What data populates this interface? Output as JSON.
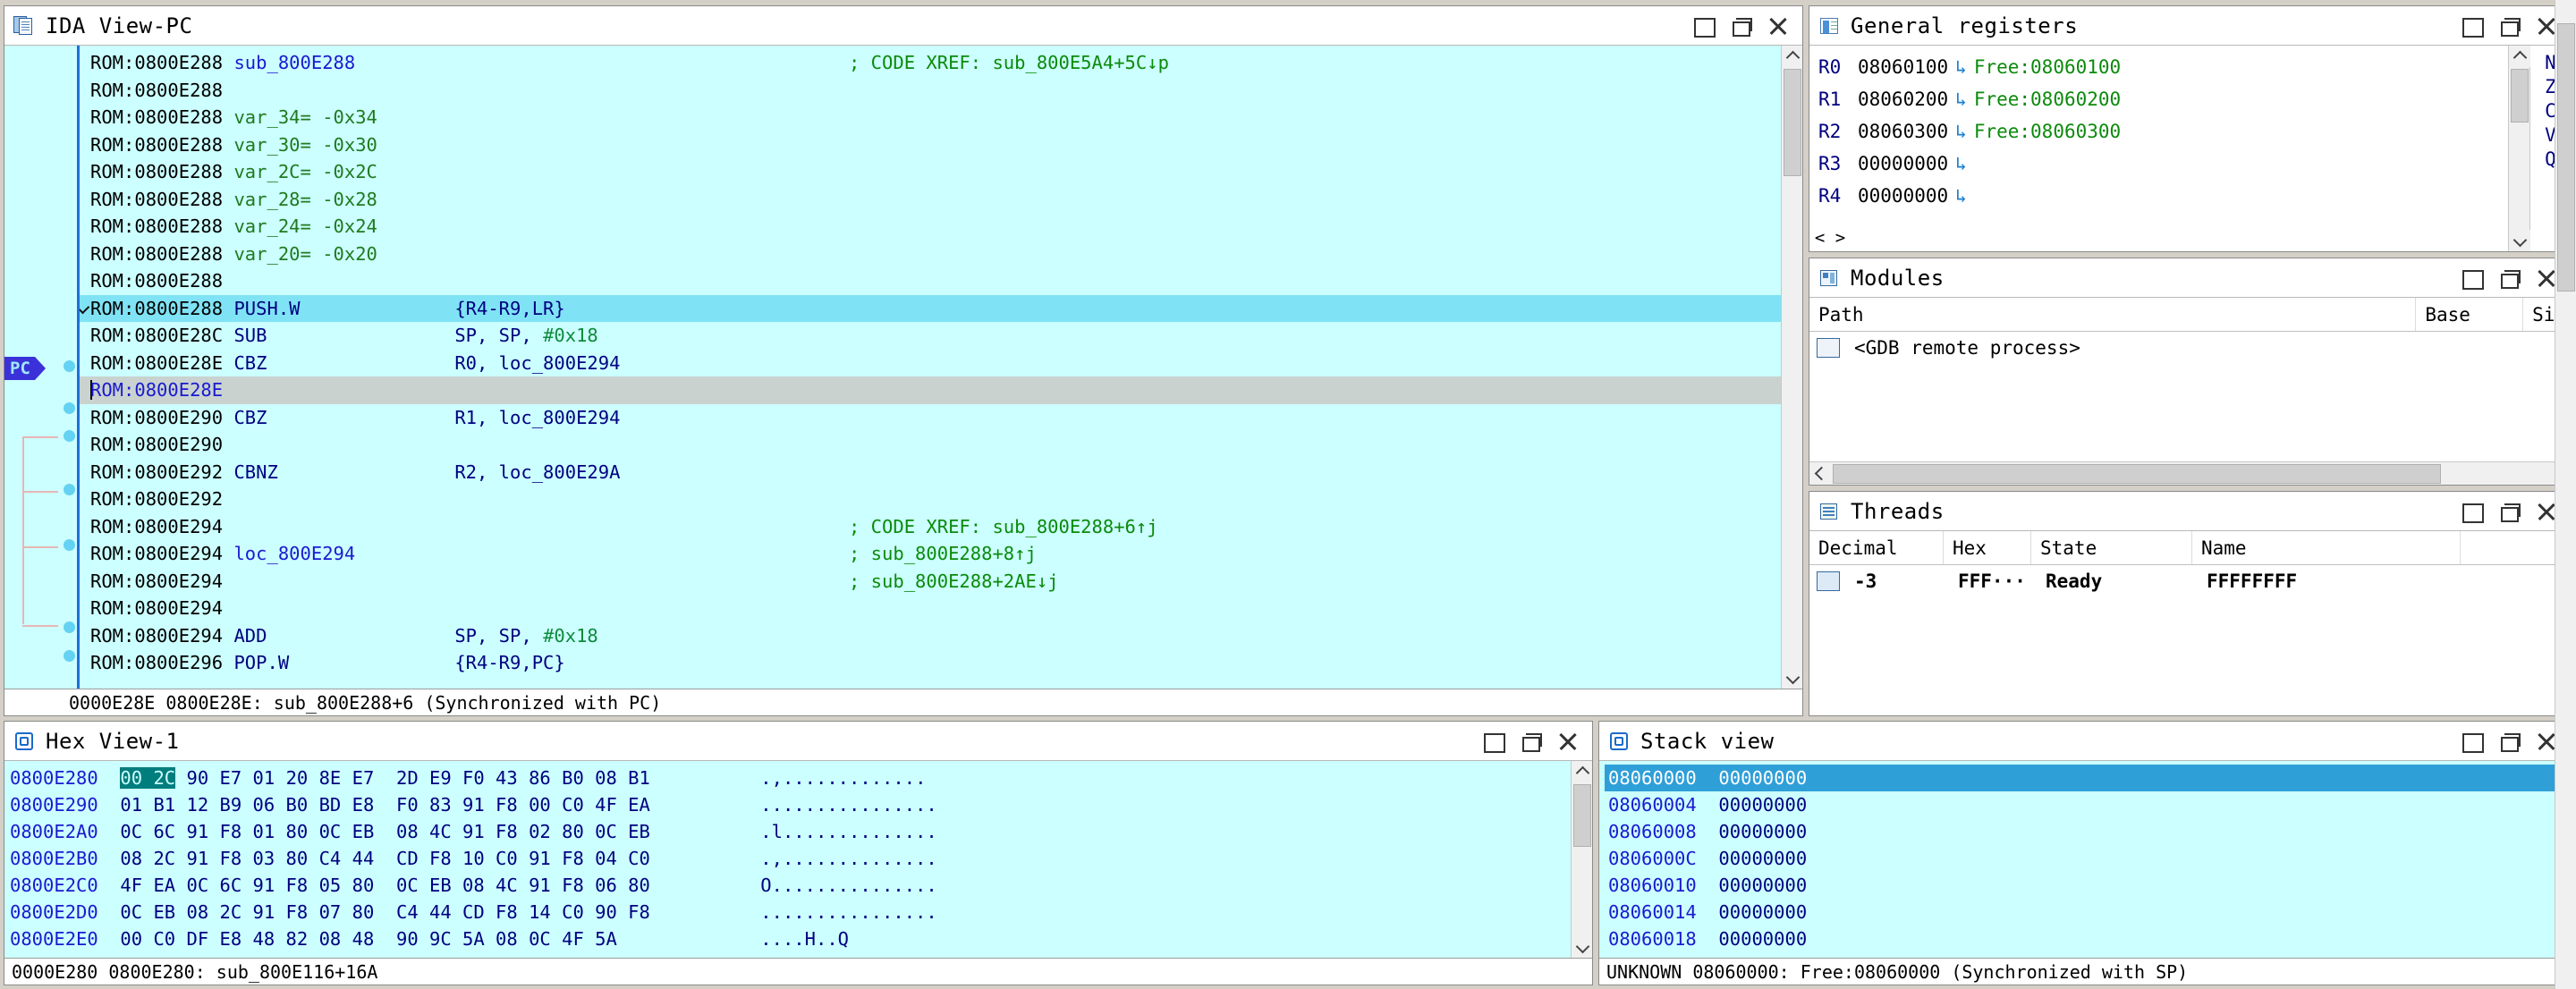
{
  "ida_view": {
    "title": "IDA View-PC",
    "icon": "document-pages-icon",
    "pc_marker": "PC",
    "comment_column": [
      {
        "row": 0,
        "text": "; CODE XREF: sub_800E5A4+5C↓p"
      },
      {
        "row": 17,
        "text": "; CODE XREF: sub_800E288+6↑j"
      },
      {
        "row": 18,
        "text": "; sub_800E288+8↑j"
      },
      {
        "row": 19,
        "text": "; sub_800E288+2AE↓j"
      }
    ],
    "lines": [
      {
        "seg": "ROM:0800E288",
        "mnem": "",
        "op": "",
        "name": "sub_800E288"
      },
      {
        "seg": "ROM:0800E288",
        "mnem": "",
        "op": ""
      },
      {
        "seg": "ROM:0800E288",
        "var": "var_34= -0x34"
      },
      {
        "seg": "ROM:0800E288",
        "var": "var_30= -0x30"
      },
      {
        "seg": "ROM:0800E288",
        "var": "var_2C= -0x2C"
      },
      {
        "seg": "ROM:0800E288",
        "var": "var_28= -0x28"
      },
      {
        "seg": "ROM:0800E288",
        "var": "var_24= -0x24"
      },
      {
        "seg": "ROM:0800E288",
        "var": "var_20= -0x20"
      },
      {
        "seg": "ROM:0800E288",
        "mnem": "",
        "op": ""
      },
      {
        "seg": "ROM:0800E288",
        "mnem": "PUSH.W",
        "op": "{R4-R9,LR}",
        "pc": true,
        "chevron": true
      },
      {
        "seg": "ROM:0800E28C",
        "mnem": "SUB",
        "op": "SP, SP, #0x18"
      },
      {
        "seg": "ROM:0800E28E",
        "mnem": "CBZ",
        "op": "R0, loc_800E294"
      },
      {
        "seg": "ROM:0800E28E",
        "mnem": "",
        "op": "",
        "cursor": true
      },
      {
        "seg": "ROM:0800E290",
        "mnem": "CBZ",
        "op": "R1, loc_800E294"
      },
      {
        "seg": "ROM:0800E290",
        "mnem": "",
        "op": ""
      },
      {
        "seg": "ROM:0800E292",
        "mnem": "CBNZ",
        "op": "R2, loc_800E29A"
      },
      {
        "seg": "ROM:0800E292",
        "mnem": "",
        "op": ""
      },
      {
        "seg": "ROM:0800E294",
        "mnem": "",
        "op": ""
      },
      {
        "seg": "ROM:0800E294",
        "mnem": "",
        "op": "",
        "name": "loc_800E294"
      },
      {
        "seg": "ROM:0800E294",
        "mnem": "",
        "op": ""
      },
      {
        "seg": "ROM:0800E294",
        "mnem": "",
        "op": ""
      },
      {
        "seg": "ROM:0800E294",
        "mnem": "ADD",
        "op": "SP, SP, #0x18"
      },
      {
        "seg": "ROM:0800E296",
        "mnem": "POP.W",
        "op": "{R4-R9,PC}"
      }
    ],
    "statusbar": "0000E28E 0800E28E: sub_800E288+6 (Synchronized with PC)"
  },
  "registers": {
    "title": "General registers",
    "icon": "registers-icon",
    "rows": [
      {
        "name": "R0",
        "value": "08060100",
        "arrow": "↳",
        "symbol": "Free:08060100"
      },
      {
        "name": "R1",
        "value": "08060200",
        "arrow": "↳",
        "symbol": "Free:08060200"
      },
      {
        "name": "R2",
        "value": "08060300",
        "arrow": "↳",
        "symbol": "Free:08060300"
      },
      {
        "name": "R3",
        "value": "00000000",
        "arrow": "↳",
        "symbol": ""
      },
      {
        "name": "R4",
        "value": "00000000",
        "arrow": "↳",
        "symbol": ""
      }
    ],
    "flags": [
      "N",
      "Z",
      "C",
      "V",
      "Q"
    ]
  },
  "modules": {
    "title": "Modules",
    "icon": "modules-icon",
    "columns": [
      "Path",
      "Base",
      "Si"
    ],
    "rows": [
      {
        "path": "<GDB remote process>",
        "base": "",
        "size": ""
      }
    ]
  },
  "threads": {
    "title": "Threads",
    "icon": "threads-icon",
    "columns": [
      "Decimal",
      "Hex",
      "State",
      "Name"
    ],
    "rows": [
      {
        "decimal": "-3",
        "hex": "FFF···",
        "state": "Ready",
        "name": "FFFFFFFF"
      }
    ]
  },
  "hex_view": {
    "title": "Hex View-1",
    "icon": "hex-icon",
    "rows": [
      {
        "addr": "0800E280",
        "bytes_sel": "00 2C",
        "bytes": "90 E7 01 20 8E E7  2D E9 F0 43 86 B0 08 B1",
        "ascii": ".,............."
      },
      {
        "addr": "0800E290",
        "bytes_sel": "",
        "bytes": "01 B1 12 B9 06 B0 BD E8  F0 83 91 F8 00 C0 4F EA",
        "ascii": "................"
      },
      {
        "addr": "0800E2A0",
        "bytes_sel": "",
        "bytes": "0C 6C 91 F8 01 80 0C EB  08 4C 91 F8 02 80 0C EB",
        "ascii": ".l.............."
      },
      {
        "addr": "0800E2B0",
        "bytes_sel": "",
        "bytes": "08 2C 91 F8 03 80 C4 44  CD F8 10 C0 91 F8 04 C0",
        "ascii": ".,.............."
      },
      {
        "addr": "0800E2C0",
        "bytes_sel": "",
        "bytes": "4F EA 0C 6C 91 F8 05 80  0C EB 08 4C 91 F8 06 80",
        "ascii": "O..............."
      },
      {
        "addr": "0800E2D0",
        "bytes_sel": "",
        "bytes": "0C EB 08 2C 91 F8 07 80  C4 44 CD F8 14 C0 90 F8",
        "ascii": "................"
      },
      {
        "addr": "0800E2E0",
        "bytes_sel": "",
        "bytes": "00 C0 DF E8 48 82 08 48  90 9C 5A 08 0C 4F 5A",
        "ascii": "....H..Q"
      }
    ],
    "statusbar": "0000E280 0800E280: sub_800E116+16A"
  },
  "stack_view": {
    "title": "Stack view",
    "icon": "stack-icon",
    "rows": [
      {
        "addr": "08060000",
        "value": "00000000",
        "selected": true
      },
      {
        "addr": "08060004",
        "value": "00000000",
        "selected": false
      },
      {
        "addr": "08060008",
        "value": "00000000",
        "selected": false
      },
      {
        "addr": "0806000C",
        "value": "00000000",
        "selected": false
      },
      {
        "addr": "08060010",
        "value": "00000000",
        "selected": false
      },
      {
        "addr": "08060014",
        "value": "00000000",
        "selected": false
      },
      {
        "addr": "08060018",
        "value": "00000000",
        "selected": false
      }
    ],
    "statusbar": "UNKNOWN 08060000: Free:08060000 (Synchronized with SP)"
  },
  "window_buttons": {
    "minimize": "minimize",
    "restore": "restore",
    "maximize": "maximize",
    "close": "close"
  },
  "colors": {
    "code_bg": "#ccffff",
    "pc_line": "#7fe3f5",
    "cursor_line": "#c9d2cf",
    "pc_tag": "#3a32d8",
    "selection": "#2f9fd8",
    "hex_selection": "#007d7d",
    "accent_border": "#1e6fd9"
  }
}
